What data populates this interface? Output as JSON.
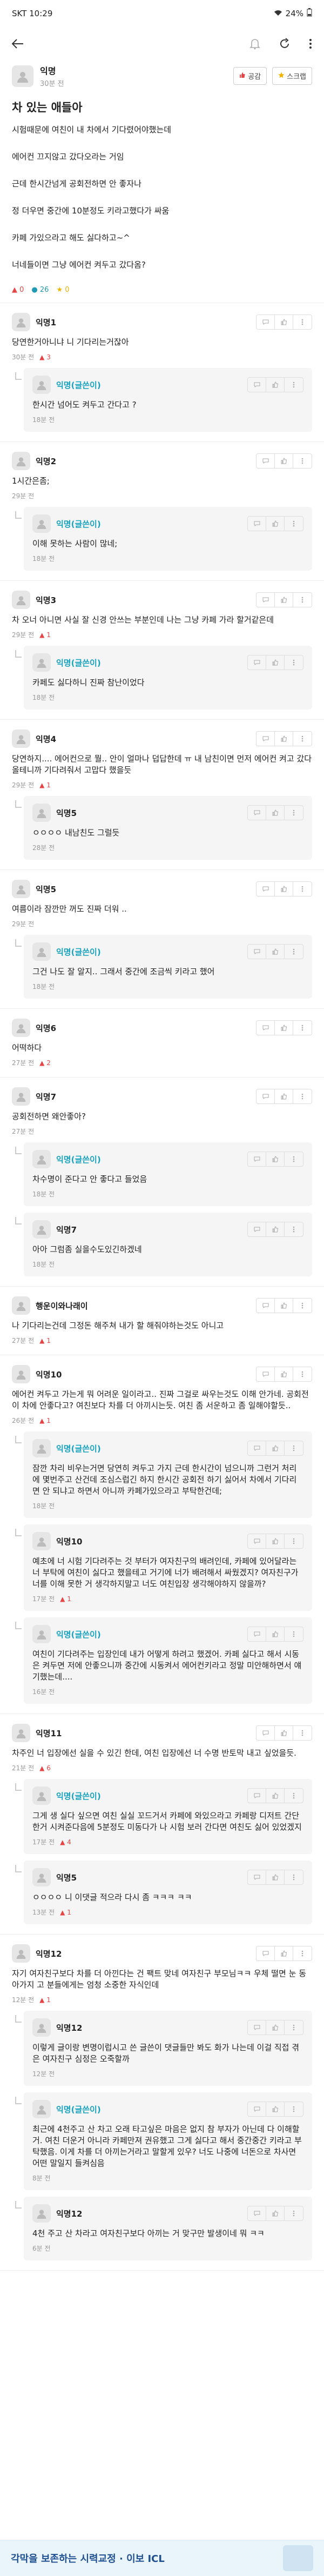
{
  "status": {
    "carrier": "SKT",
    "time": "10:29",
    "battery": "24%"
  },
  "post": {
    "author": "익명",
    "time": "30분 전",
    "like_label": "공감",
    "scrap_label": "스크랩",
    "title": "차 있는 애들아",
    "body": [
      "시험때문에 여친이 내 차에서 기다렸어야했는데",
      "에어컨 끄지않고 갔다오라는 거임",
      "근데 한시간넘게 공회전하면 안 좋자나",
      "정 더우면 중간에 10분정도 키라고했다가 싸움",
      "카페 가있으라고 해도 싫다하고~^",
      "너네들이면 그냥 에어컨 켜두고 갔다옴?"
    ],
    "likes": "0",
    "comments": "26",
    "scraps": "0"
  },
  "comments": [
    {
      "name": "익명1",
      "text": "당연한거아니냐 니 기다리는거잖아",
      "time": "30분 전",
      "likes": "3",
      "replies": [
        {
          "name": "익명(글쓴이)",
          "text": "한시간 넘어도 켜두고 간다고 ?",
          "time": "18분 전"
        }
      ]
    },
    {
      "name": "익명2",
      "text": "1시간은좀;",
      "time": "29분 전",
      "likes": "",
      "replies": [
        {
          "name": "익명(글쓴이)",
          "text": "이해 못하는 사람이 많네;",
          "time": "18분 전"
        }
      ]
    },
    {
      "name": "익명3",
      "text": "차 오너 아니면 사실 잘 신경 안쓰는 부분인데 나는 그냥 카페 가라 할거같은데",
      "time": "29분 전",
      "likes": "1",
      "replies": [
        {
          "name": "익명(글쓴이)",
          "text": "카페도 싫다하니 진짜 참난이었다",
          "time": "18분 전"
        }
      ]
    },
    {
      "name": "익명4",
      "text": "당연하지.... 에어컨으로 뭘.. 안이 얼마나 덥답한데 ㅠ 내 남친이면 먼저 에어컨 켜고 갔다올테니까 기다려줘서 고맙다 했을듯",
      "time": "29분 전",
      "likes": "1",
      "replies": [
        {
          "name": "익명5",
          "text": "ㅇㅇㅇㅇ 내남친도 그럴듯",
          "time": "28분 전"
        }
      ]
    },
    {
      "name": "익명5",
      "text": "여름이라 잠깐만 꺼도 진짜 더워 ..",
      "time": "29분 전",
      "likes": "",
      "replies": [
        {
          "name": "익명(글쓴이)",
          "text": "그건 나도 잘 알지.. 그래서 중간에 조금씩 키라고 했어",
          "time": "18분 전"
        }
      ]
    },
    {
      "name": "익명6",
      "text": "어떡하다",
      "time": "27분 전",
      "likes": "2",
      "replies": []
    },
    {
      "name": "익명7",
      "text": "공회전하면 왜안좋아?",
      "time": "27분 전",
      "likes": "",
      "replies": [
        {
          "name": "익명(글쓴이)",
          "text": "차수명이 준다고 안 좋다고 들었음",
          "time": "18분 전"
        },
        {
          "name": "익명7",
          "text": "아아 그럼좀 실을수도있긴하겠네",
          "time": "18분 전"
        }
      ]
    },
    {
      "name": "행운이와나래이",
      "text": "나 기다리는건데 그정돈 해주쳐 내가 할 해줘야하는것도 아니고",
      "time": "27분 전",
      "likes": "1",
      "replies": []
    },
    {
      "name": "익명10",
      "text": "에어컨 켜두고 가는게 뭐 어려운 일이라고.. 진짜 그걸로 싸우는것도 이해 안가네. 공회전이 차에 안좋다고? 여친보다 차를 더 아끼시는듯. 여친 좀 서운하고 좀 일해야할듯..",
      "time": "26분 전",
      "likes": "1",
      "replies": [
        {
          "name": "익명(글쓴이)",
          "text": "잠깐 차리 비우는거면 당연히 켜두고 가지 근데 한시간이 넘으니까 그런거 처리에 몇번주고 산건데 조심스럽긴 하지 한시간 공회전 하기 싫어서 차에서 기다리면 안 되냐고 하면서 아니까 카페가있으라고 부탁한건데;",
          "time": "18분 전"
        },
        {
          "name": "익명10",
          "text": "예초에 너 시험 기다려주는 것 부터가 여자친구의 배려인데, 카페에 있어달라는 너 부탁에 여친이 싫다고 했을테고 거기에 너가 배려해서 싸웠겠지? 여자친구가 너를 이해 못한 거 생각하지말고 너도 여친입장 생각해야하지 않을까?",
          "time": "17분 전",
          "likes": "1"
        },
        {
          "name": "익명(글쓴이)",
          "text": "여친이 기다려주는 입장인데 내가 어떻게 하려고 했겠어. 카페 싫다고 해서 시동은 켜두면 저에 안좋으니까 중간에 시동켜서 에어컨키라고 정말 미안해하면서 얘기했는데....",
          "time": "16분 전"
        }
      ]
    },
    {
      "name": "익명11",
      "text": "차주인 너 입장에선 실을 수 있긴 한데, 여친 입장에선 너 수명 반토막 내고 싶었을듯.",
      "time": "21분 전",
      "likes": "6",
      "replies": [
        {
          "name": "익명(글쓴이)",
          "text": "그게 생 실다 싶으면 여친 실실 꼬드거서 카페에 와있으라고 카페랑 디저트 간단한거 시켜준다음에 5분정도 미동다가 나 시험 보러 간다면 여친도 싫어 있었겠지",
          "time": "17분 전",
          "likes": "4"
        },
        {
          "name": "익명5",
          "text": "ㅇㅇㅇㅇ 니 이댓글 적으라 다시 좀 ㅋㅋㅋ ㅋㅋ",
          "time": "13분 전",
          "likes": "1"
        }
      ]
    },
    {
      "name": "익명12",
      "text": "자기 여자친구보다 차를 더 아낀다는 건 팩트 맞네 여자친구 부모님ㅋㅋ 우체 떨면 눈 동아가지 고 분들에게는 엄청 소중한 자식인데",
      "time": "12분 전",
      "likes": "1",
      "replies": [
        {
          "name": "익명12",
          "text": "이렇게 글이랑 변명이럽시고 쓴 글쓴이 댓글들만 봐도 화가 나는데 이걸 직접 겪은 여자친구 심정은 오죽할까",
          "time": "12분 전"
        },
        {
          "name": "익명(글쓴이)",
          "text": "최근에 4천주고 산 차고 오래 타고싶은 마음은 없지 참 부자가 아닌데 다 이해할거. 여친 더운거 아니라 카페만져 권유했고 그게 싫다고 해서 중간중간 키라고 부탁했음. 이게 차를 더 아끼는거라고 말할게 있우? 너도 나중에 너돈으로 차사면 어떤 말일지 들켜심음",
          "time": "8분 전"
        },
        {
          "name": "익명12",
          "text": "4천 주고 산 차라고 여자친구보다 아끼는 거 맞구만 발생이네 뭐 ㅋㅋ",
          "time": "6분 전"
        }
      ]
    }
  ],
  "banner": {
    "text": "각막을 보존하는 시력교정 · 이보 ICL"
  }
}
